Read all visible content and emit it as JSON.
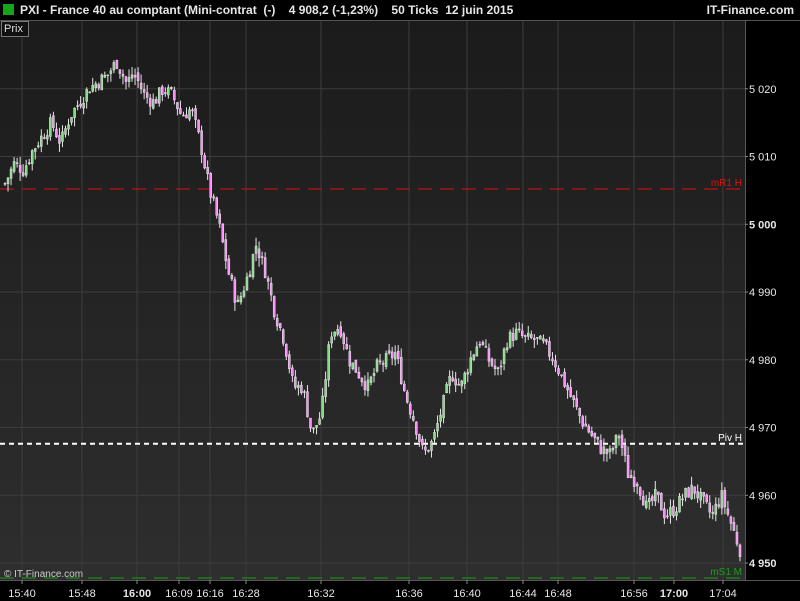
{
  "header": {
    "title": "PXI - France 40 au comptant (Mini-contrat  (-)    4 908,2 (-1,23%)    50 Ticks  12 juin 2015",
    "brand": "IT-Finance.com"
  },
  "prix_label": "Prix",
  "copyright": "© IT-Finance.com",
  "colors": {
    "background_top": "#1b1b1b",
    "background_bottom": "#2e2e2e",
    "grid": "#3c3c3c",
    "candle": "#e6e6e6",
    "candle_up": "#7fdc7f",
    "candle_down": "#ff88ff",
    "mR1": "#e01010",
    "pivot": "#ffffff",
    "mS1": "#18a018"
  },
  "chart_data": {
    "type": "candlestick",
    "title": "PXI - France 40 au comptant",
    "ylabel": "Prix",
    "ylim": [
      4947.5,
      5030
    ],
    "y_ticks": [
      {
        "value": 5020,
        "label": "5 020",
        "bold": false
      },
      {
        "value": 5010,
        "label": "5 010",
        "bold": false
      },
      {
        "value": 5000,
        "label": "5 000",
        "bold": true
      },
      {
        "value": 4990,
        "label": "4 990",
        "bold": false
      },
      {
        "value": 4980,
        "label": "4 980",
        "bold": false
      },
      {
        "value": 4970,
        "label": "4 970",
        "bold": false
      },
      {
        "value": 4960,
        "label": "4 960",
        "bold": false
      },
      {
        "value": 4950,
        "label": "4 950",
        "bold": true
      }
    ],
    "x_ticks": [
      {
        "label": "15:40",
        "bold": false
      },
      {
        "label": "15:48",
        "bold": false
      },
      {
        "label": "16:00",
        "bold": true
      },
      {
        "label": "16:09",
        "bold": false
      },
      {
        "label": "16:16",
        "bold": false
      },
      {
        "label": "16:28",
        "bold": false
      },
      {
        "label": "16:32",
        "bold": false
      },
      {
        "label": "16:36",
        "bold": false
      },
      {
        "label": "16:40",
        "bold": false
      },
      {
        "label": "16:44",
        "bold": false
      },
      {
        "label": "16:48",
        "bold": false
      },
      {
        "label": "16:56",
        "bold": false
      },
      {
        "label": "17:00",
        "bold": true
      },
      {
        "label": "17:04",
        "bold": false
      }
    ],
    "levels": [
      {
        "name": "mR1 H",
        "value": 5005.2,
        "color": "#e01010",
        "style": "dashed"
      },
      {
        "name": "Piv H",
        "value": 4967.6,
        "color": "#ffffff",
        "style": "dashed"
      },
      {
        "name": "mS1 M",
        "value": 4947.8,
        "color": "#18a018",
        "style": "dashed"
      }
    ],
    "close_path": [
      5006,
      5009,
      5008,
      5011,
      5013,
      5015,
      5012,
      5016,
      5018,
      5020,
      5021,
      5022,
      5024,
      5021,
      5022,
      5019,
      5018,
      5020,
      5019,
      5016,
      5017,
      5012,
      5005,
      5000,
      4993,
      4988,
      4992,
      4997,
      4993,
      4987,
      4983,
      4976,
      4976,
      4969,
      4972,
      4984,
      4985,
      4980,
      4978,
      4976,
      4979,
      4980,
      4981,
      4975,
      4971,
      4966,
      4968,
      4973,
      4978,
      4976,
      4980,
      4983,
      4980,
      4978,
      4983,
      4984,
      4983,
      4983,
      4982,
      4980,
      4977,
      4974,
      4971,
      4969,
      4967,
      4966,
      4969,
      4963,
      4962,
      4958,
      4960,
      4957,
      4958,
      4960,
      4961,
      4959,
      4957,
      4960,
      4956,
      4952
    ]
  }
}
